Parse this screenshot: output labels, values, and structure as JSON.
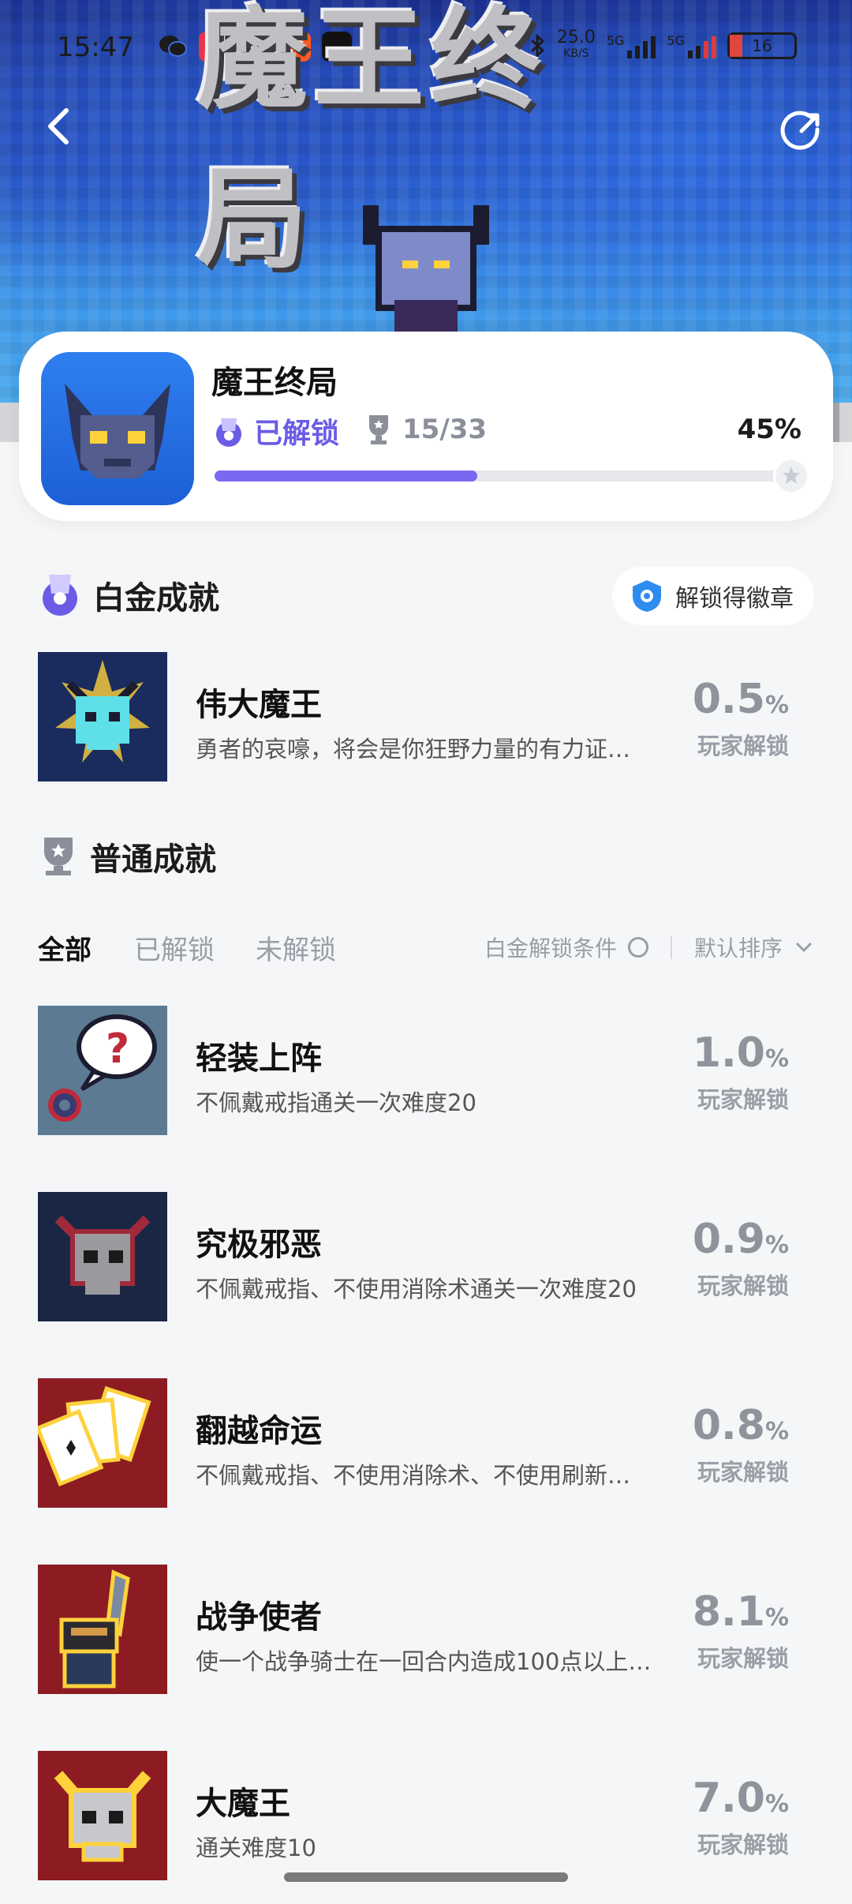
{
  "status_bar": {
    "time": "15:47",
    "network_speed": "25.0",
    "network_unit": "KB/S",
    "signal_1": "5G",
    "signal_2": "5G",
    "battery": "16"
  },
  "header": {
    "back_icon": "chevron-left-icon",
    "share_icon": "share-icon",
    "logo_text": "魔王终局"
  },
  "game_card": {
    "title": "魔王终局",
    "unlocked_label": "已解锁",
    "count": "15/33",
    "percent": "45%",
    "progress": 0.45
  },
  "platinum": {
    "section_title": "白金成就",
    "badge_button": "解锁得徽章",
    "item": {
      "name": "伟大魔王",
      "desc": "勇者的哀嚎，将会是你狂野力量的有力证…",
      "pct_value": "0.5",
      "pct_unit": "%",
      "caption": "玩家解锁"
    }
  },
  "normal": {
    "section_title": "普通成就",
    "tabs": [
      "全部",
      "已解锁",
      "未解锁"
    ],
    "active_tab": 0,
    "filter_label": "白金解锁条件",
    "sort_label": "默认排序",
    "items": [
      {
        "name": "轻装上阵",
        "desc": "不佩戴戒指通关一次难度20",
        "pct_value": "1.0",
        "pct_unit": "%",
        "caption": "玩家解锁"
      },
      {
        "name": "究极邪恶",
        "desc": "不佩戴戒指、不使用消除术通关一次难度20",
        "pct_value": "0.9",
        "pct_unit": "%",
        "caption": "玩家解锁"
      },
      {
        "name": "翻越命运",
        "desc": "不佩戴戒指、不使用消除术、不使用刷新…",
        "pct_value": "0.8",
        "pct_unit": "%",
        "caption": "玩家解锁"
      },
      {
        "name": "战争使者",
        "desc": "使一个战争骑士在一回合内造成100点以上…",
        "pct_value": "8.1",
        "pct_unit": "%",
        "caption": "玩家解锁"
      },
      {
        "name": "大魔王",
        "desc": "通关难度10",
        "pct_value": "7.0",
        "pct_unit": "%",
        "caption": "玩家解锁"
      }
    ]
  }
}
